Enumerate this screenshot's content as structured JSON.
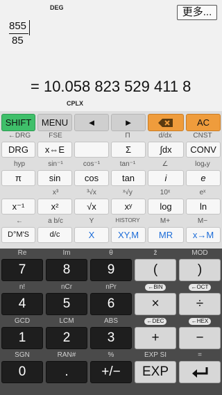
{
  "display": {
    "angle_mode": "DEG",
    "more_label": "更多...",
    "fraction_numerator": "855",
    "fraction_denominator": "85",
    "result": "= 10.058 823 529 411 8",
    "mode_indicator": "CPLX"
  },
  "row0": {
    "shift": "SHIFT",
    "menu": "MENU",
    "left": "◄",
    "right": "►",
    "ac": "AC"
  },
  "row1": {
    "sec": [
      "←DRG",
      "FSE",
      "",
      "Π",
      "d/dx",
      "CNST"
    ],
    "keys": [
      "DRG",
      "x⇔E",
      "",
      "Σ",
      "∫dx",
      "CONV"
    ]
  },
  "row2": {
    "sec": [
      "hyp",
      "sin⁻¹",
      "cos⁻¹",
      "tan⁻¹",
      "∠",
      "logₓy"
    ],
    "keys": [
      "π",
      "sin",
      "cos",
      "tan",
      "i",
      "e"
    ]
  },
  "row3": {
    "sec": [
      "",
      "x³",
      "³√x",
      "ˣ√y",
      "10ˣ",
      "eˣ"
    ],
    "keys": [
      "x⁻¹",
      "x²",
      "√x",
      "xʸ",
      "log",
      "ln"
    ]
  },
  "row4": {
    "sec": [
      "←",
      "a b/c",
      "Y",
      "HISTORY",
      "M+",
      "M−"
    ],
    "keys": [
      "D°M'S",
      "d/c",
      "X",
      "XY,M",
      "MR",
      "x→M"
    ]
  },
  "row5": {
    "sec": [
      "Re",
      "Im",
      "θ",
      "z̄",
      "MOD"
    ],
    "keys": [
      "7",
      "8",
      "9",
      "(",
      ")"
    ]
  },
  "row6": {
    "sec": [
      "n!",
      "nCr",
      "nPr",
      "←BIN",
      "←OCT"
    ],
    "keys": [
      "4",
      "5",
      "6",
      "×",
      "÷"
    ]
  },
  "row7": {
    "sec": [
      "GCD",
      "LCM",
      "ABS",
      "←DEC",
      "←HEX"
    ],
    "keys": [
      "1",
      "2",
      "3",
      "+",
      "−"
    ]
  },
  "row8": {
    "sec": [
      "SGN",
      "RAN#",
      "%",
      "EXP SI",
      "="
    ],
    "keys": [
      "0",
      ".",
      "+/−",
      "EXP",
      "↵"
    ]
  },
  "icons": {
    "backspace": "backspace-icon",
    "enter": "enter-icon"
  }
}
